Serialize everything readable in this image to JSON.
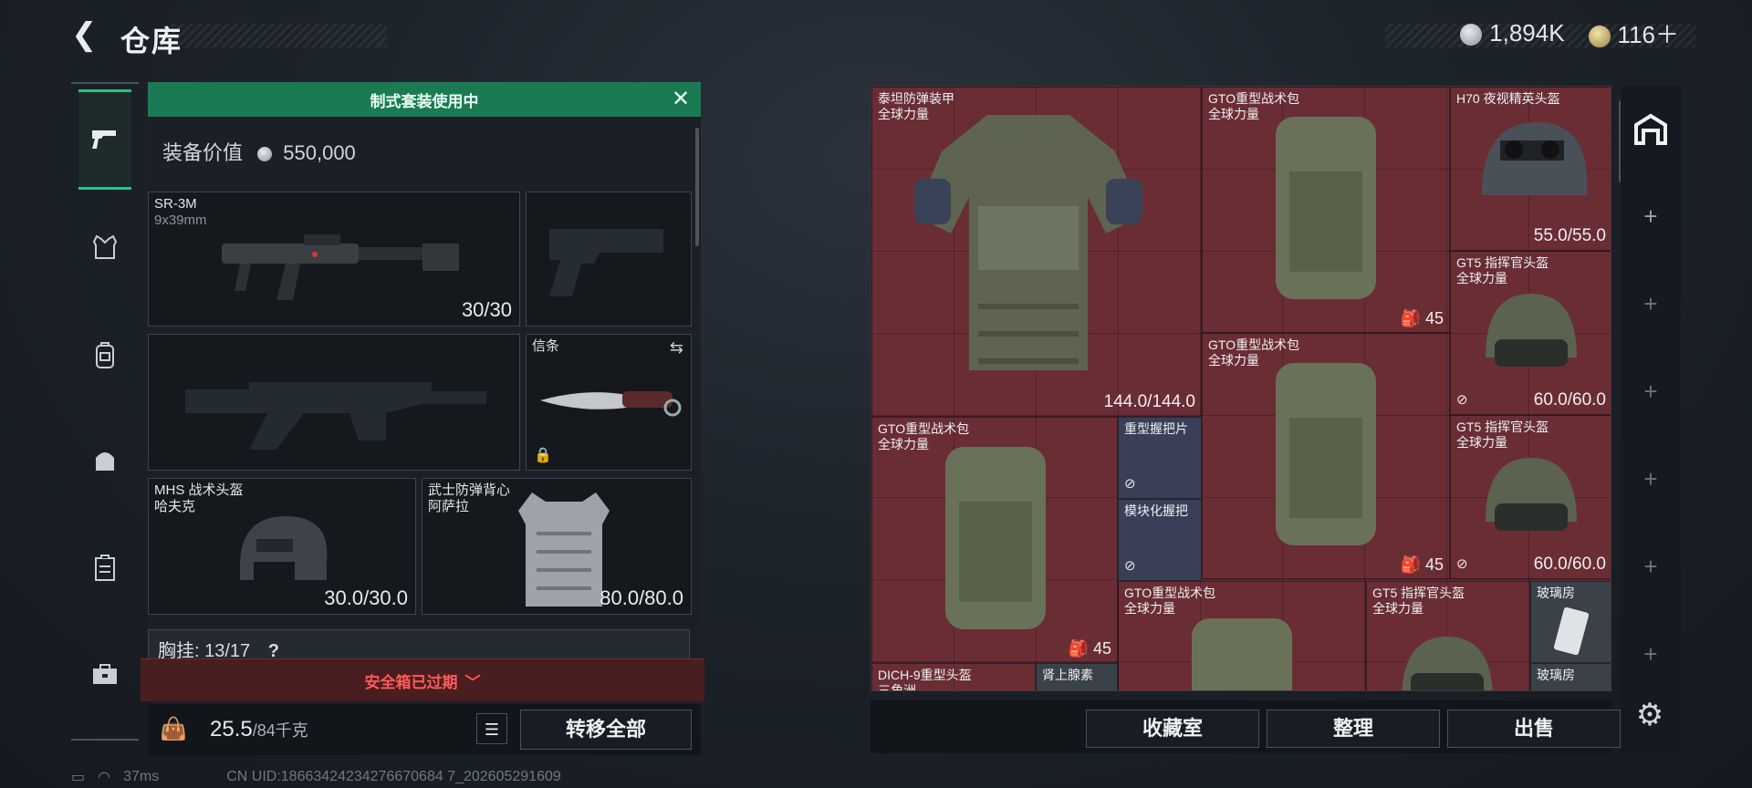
{
  "header": {
    "title": "仓库",
    "back_icon": "chevron-left-icon",
    "currency_silver": "1,894K",
    "currency_gold": "116＋",
    "silver_icon": "silver-coin-icon",
    "gold_icon": "gold-coin-icon"
  },
  "leftnav": {
    "icons": [
      "pistol-icon",
      "vest-icon",
      "backpack-icon",
      "rig-icon",
      "container-icon",
      "toolbox-icon"
    ]
  },
  "loadout": {
    "banner": "制式套装使用中",
    "value_label": "装备价值",
    "value": "550,000",
    "slots": {
      "primary": {
        "name": "SR-3M",
        "sub": "9x39mm",
        "durability": "30/30"
      },
      "melee": {
        "name": "信条"
      },
      "helmet": {
        "name": "MHS 战术头盔",
        "sub": "哈夫克",
        "durability": "30.0/30.0"
      },
      "armor": {
        "name": "武士防弹背心",
        "sub": "阿萨拉",
        "durability": "80.0/80.0"
      }
    },
    "chest_rig": "胸挂: 13/17",
    "chest_help": "?",
    "safebox": "安全箱已过期",
    "weight": "25.5",
    "weight_cap": "/84千克",
    "transfer_all": "转移全部"
  },
  "stash": {
    "items": [
      {
        "name": "泰坦防弹装甲",
        "sub": "全球力量",
        "durability": "144.0/144.0"
      },
      {
        "name": "GTO重型战术包",
        "sub": "全球力量",
        "count": "45"
      },
      {
        "name": "H70 夜视精英头盔",
        "durability": "55.0/55.0"
      },
      {
        "name": "GT5 指挥官头盔",
        "sub": "全球力量",
        "durability": "60.0/60.0"
      },
      {
        "name": "GTO重型战术包",
        "sub": "全球力量",
        "count": "45"
      },
      {
        "name": "GTO重型战术包",
        "sub": "全球力量",
        "count": "45"
      },
      {
        "name": "重型握把片"
      },
      {
        "name": "模块化握把"
      },
      {
        "name": "GT5 指挥官头盔",
        "sub": "全球力量",
        "durability": "60.0/60.0"
      },
      {
        "name": "GTO重型战术包",
        "sub": "全球力量"
      },
      {
        "name": "GT5 指挥官头盔",
        "sub": "全球力量"
      },
      {
        "name": "玻璃房"
      },
      {
        "name": "玻璃房"
      },
      {
        "name": "DICH-9重型头盔",
        "sub": "三角洲"
      },
      {
        "name": "肾上腺素"
      }
    ],
    "buttons": {
      "collection": "收藏室",
      "sort": "整理",
      "sell": "出售"
    }
  },
  "rightnav": {
    "icons": [
      "stash-home-icon",
      "plus-icon",
      "plus-icon",
      "plus-icon",
      "plus-icon",
      "plus-icon",
      "plus-icon"
    ]
  },
  "footer": {
    "ping": "37ms",
    "uid": "CN UID:18663424234276670684 7_202605291609"
  },
  "colors": {
    "accent_green": "#1a7b52",
    "stash_red": "#6b2d34",
    "warning_red": "#ff5a5a"
  }
}
